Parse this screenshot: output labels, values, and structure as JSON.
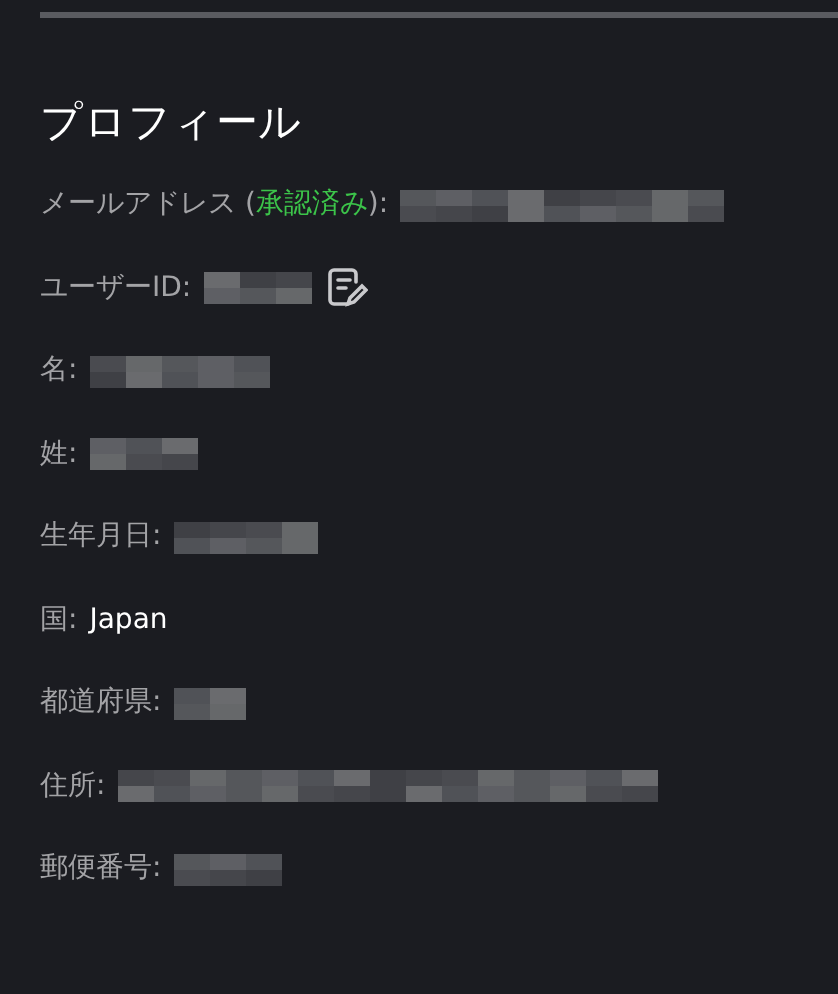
{
  "heading": "プロフィール",
  "fields": [
    {
      "label": "メールアドレス (",
      "status": "承認済み",
      "label_tail": "):",
      "redacted": true
    },
    {
      "label": "ユーザーID:",
      "redacted": true,
      "editable": true
    },
    {
      "label": "名:",
      "redacted": true
    },
    {
      "label": "姓:",
      "redacted": true
    },
    {
      "label": "生年月日:",
      "redacted": true
    },
    {
      "label": "国:",
      "value": "Japan"
    },
    {
      "label": "都道府県:",
      "redacted": true
    },
    {
      "label": "住所:",
      "redacted": true
    },
    {
      "label": "郵便番号:",
      "redacted": true
    }
  ]
}
